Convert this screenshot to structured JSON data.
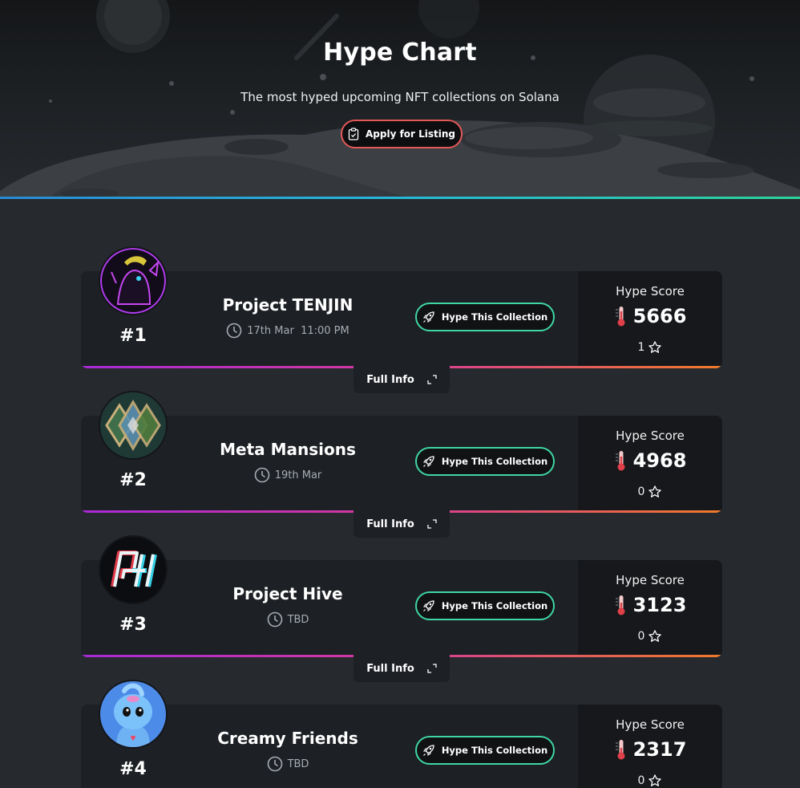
{
  "hero": {
    "title": "Hype Chart",
    "subtitle": "The most hyped upcoming NFT collections on Solana",
    "apply_label": "Apply for Listing",
    "apply_icon": "clipboard-icon"
  },
  "colors": {
    "page_bg": "#262a2e",
    "card_bg": "#1d2024",
    "score_bg": "#16181b",
    "hype_btn_border": "#3fd6a3",
    "apply_btn_border": "#e45858",
    "card_underline_start": "#a82ad6",
    "card_underline_end": "#f07a2a"
  },
  "labels": {
    "hype_button": "Hype This Collection",
    "hype_score": "Hype Score",
    "full_info": "Full Info"
  },
  "collections": [
    {
      "rank": "#1",
      "name": "Project TENJIN",
      "date": "17th Mar  11:00 PM",
      "score": "5666",
      "stars": "1",
      "avatar_icon": "tenjin-avatar"
    },
    {
      "rank": "#2",
      "name": "Meta Mansions",
      "date": "19th Mar",
      "score": "4968",
      "stars": "0",
      "avatar_icon": "meta-mansions-avatar"
    },
    {
      "rank": "#3",
      "name": "Project Hive",
      "date": "TBD",
      "score": "3123",
      "stars": "0",
      "avatar_icon": "project-hive-avatar"
    },
    {
      "rank": "#4",
      "name": "Creamy Friends",
      "date": "TBD",
      "score": "2317",
      "stars": "0",
      "avatar_icon": "creamy-friends-avatar"
    }
  ]
}
